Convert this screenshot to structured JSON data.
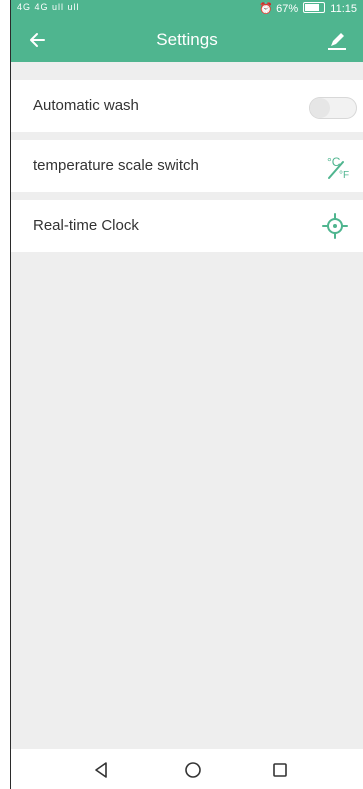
{
  "status_bar": {
    "left": "4G 4G ull ull",
    "battery_percent": "67%",
    "time": "11:15"
  },
  "app_bar": {
    "title": "Settings",
    "back_icon": "back-arrow-icon",
    "edit_icon": "edit-icon"
  },
  "settings": {
    "items": [
      {
        "label": "Automatic wash",
        "control": "toggle",
        "enabled": false
      },
      {
        "label": "temperature scale switch",
        "control": "temperature-scale-icon",
        "unit_top": "°C",
        "unit_bottom": "°F"
      },
      {
        "label": "Real-time Clock",
        "control": "crosshair-icon"
      }
    ]
  },
  "navigation": {
    "back": "triangle-back-icon",
    "home": "circle-home-icon",
    "recent": "square-recent-icon"
  },
  "colors": {
    "header": "#4fb58f",
    "background": "#eeeeee",
    "row": "#ffffff",
    "text": "#333333",
    "accent": "#4fb58f"
  }
}
